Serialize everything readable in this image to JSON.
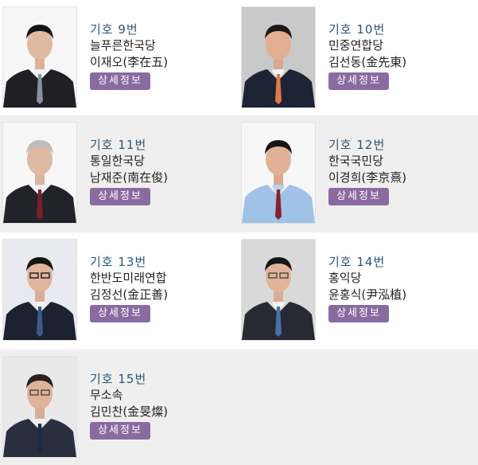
{
  "candidates": [
    {
      "number": "기호 9번",
      "party": "늘푸른한국당",
      "name": "이재오(李在五)",
      "detail_label": "상세정보"
    },
    {
      "number": "기호 10번",
      "party": "민중연합당",
      "name": "김선동(金先東)",
      "detail_label": "상세정보"
    },
    {
      "number": "기호 11번",
      "party": "통일한국당",
      "name": "남재준(南在俊)",
      "detail_label": "상세정보"
    },
    {
      "number": "기호 12번",
      "party": "한국국민당",
      "name": "이경희(李京熹)",
      "detail_label": "상세정보"
    },
    {
      "number": "기호 13번",
      "party": "한반도미래연합",
      "name": "김정선(金正善)",
      "detail_label": "상세정보"
    },
    {
      "number": "기호 14번",
      "party": "홍익당",
      "name": "윤홍식(尹泓植)",
      "detail_label": "상세정보"
    },
    {
      "number": "기호 15번",
      "party": "무소속",
      "name": "김민찬(金旻燦)",
      "detail_label": "상세정보"
    }
  ],
  "colors": {
    "number_text": "#2a5579",
    "button_bg": "#8a6aa0",
    "row_alt_bg": "#efefef"
  }
}
